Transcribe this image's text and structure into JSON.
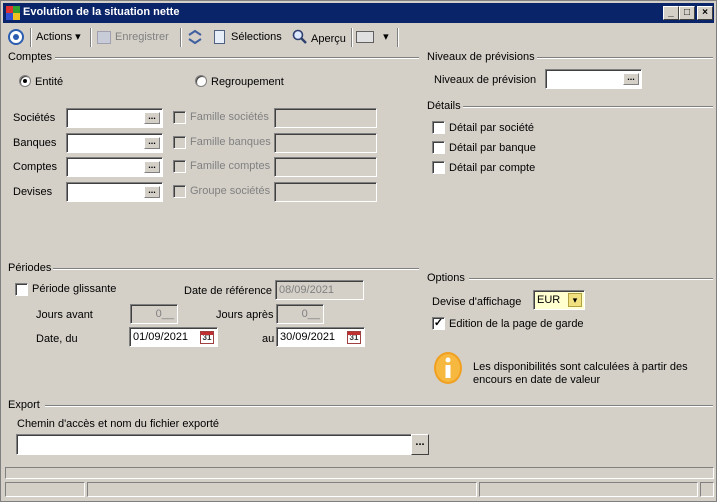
{
  "window": {
    "title": "Evolution de la situation nette"
  },
  "toolbar": {
    "actions_label": "Actions",
    "enregistrer_label": "Enregistrer",
    "selections_label": "Sélections",
    "apercu_label": "Aperçu"
  },
  "comptes": {
    "group_title": "Comptes",
    "radio_entite": "Entité",
    "radio_regroupement": "Regroupement",
    "fields": [
      {
        "label": "Sociétés",
        "value": ""
      },
      {
        "label": "Banques",
        "value": ""
      },
      {
        "label": "Comptes",
        "value": ""
      },
      {
        "label": "Devises",
        "value": ""
      }
    ],
    "family_checks": [
      {
        "label": "Famille sociétés",
        "value": ""
      },
      {
        "label": "Famille banques",
        "value": ""
      },
      {
        "label": "Famille comptes",
        "value": ""
      },
      {
        "label": "Groupe sociétés",
        "value": ""
      }
    ]
  },
  "niveaux": {
    "group_title": "Niveaux de prévisions",
    "label": "Niveaux de prévision",
    "value": ""
  },
  "details": {
    "group_title": "Détails",
    "items": [
      {
        "label": "Détail par société",
        "checked": false
      },
      {
        "label": "Détail par banque",
        "checked": false
      },
      {
        "label": "Détail par compte",
        "checked": false
      }
    ]
  },
  "periodes": {
    "group_title": "Périodes",
    "periode_glissante": "Période glissante",
    "date_reference_label": "Date de référence",
    "date_reference_value": "08/09/2021",
    "jours_avant_label": "Jours avant",
    "jours_avant_value": "0__",
    "jours_apres_label": "Jours après",
    "jours_apres_value": "0__",
    "date_du_label": "Date, du",
    "date_du_value": "01/09/2021",
    "au_label": "au",
    "au_value": "30/09/2021",
    "calendar_text": "31"
  },
  "options": {
    "group_title": "Options",
    "devise_label": "Devise d'affichage",
    "devise_value": "EUR",
    "edition_label": "Edition de la page de garde",
    "edition_checked": true,
    "info_text_1": "Les disponibilités sont calculées à partir des",
    "info_text_2": "encours en date de valeur"
  },
  "export": {
    "group_title": "Export",
    "chemin_label": "Chemin d'accès et nom du fichier exporté",
    "chemin_value": "",
    "browse_label": "..."
  },
  "colors": {
    "titlebar": "#0a246a",
    "window_bg": "#d4d0c8",
    "info_icon": "#f0a020"
  }
}
